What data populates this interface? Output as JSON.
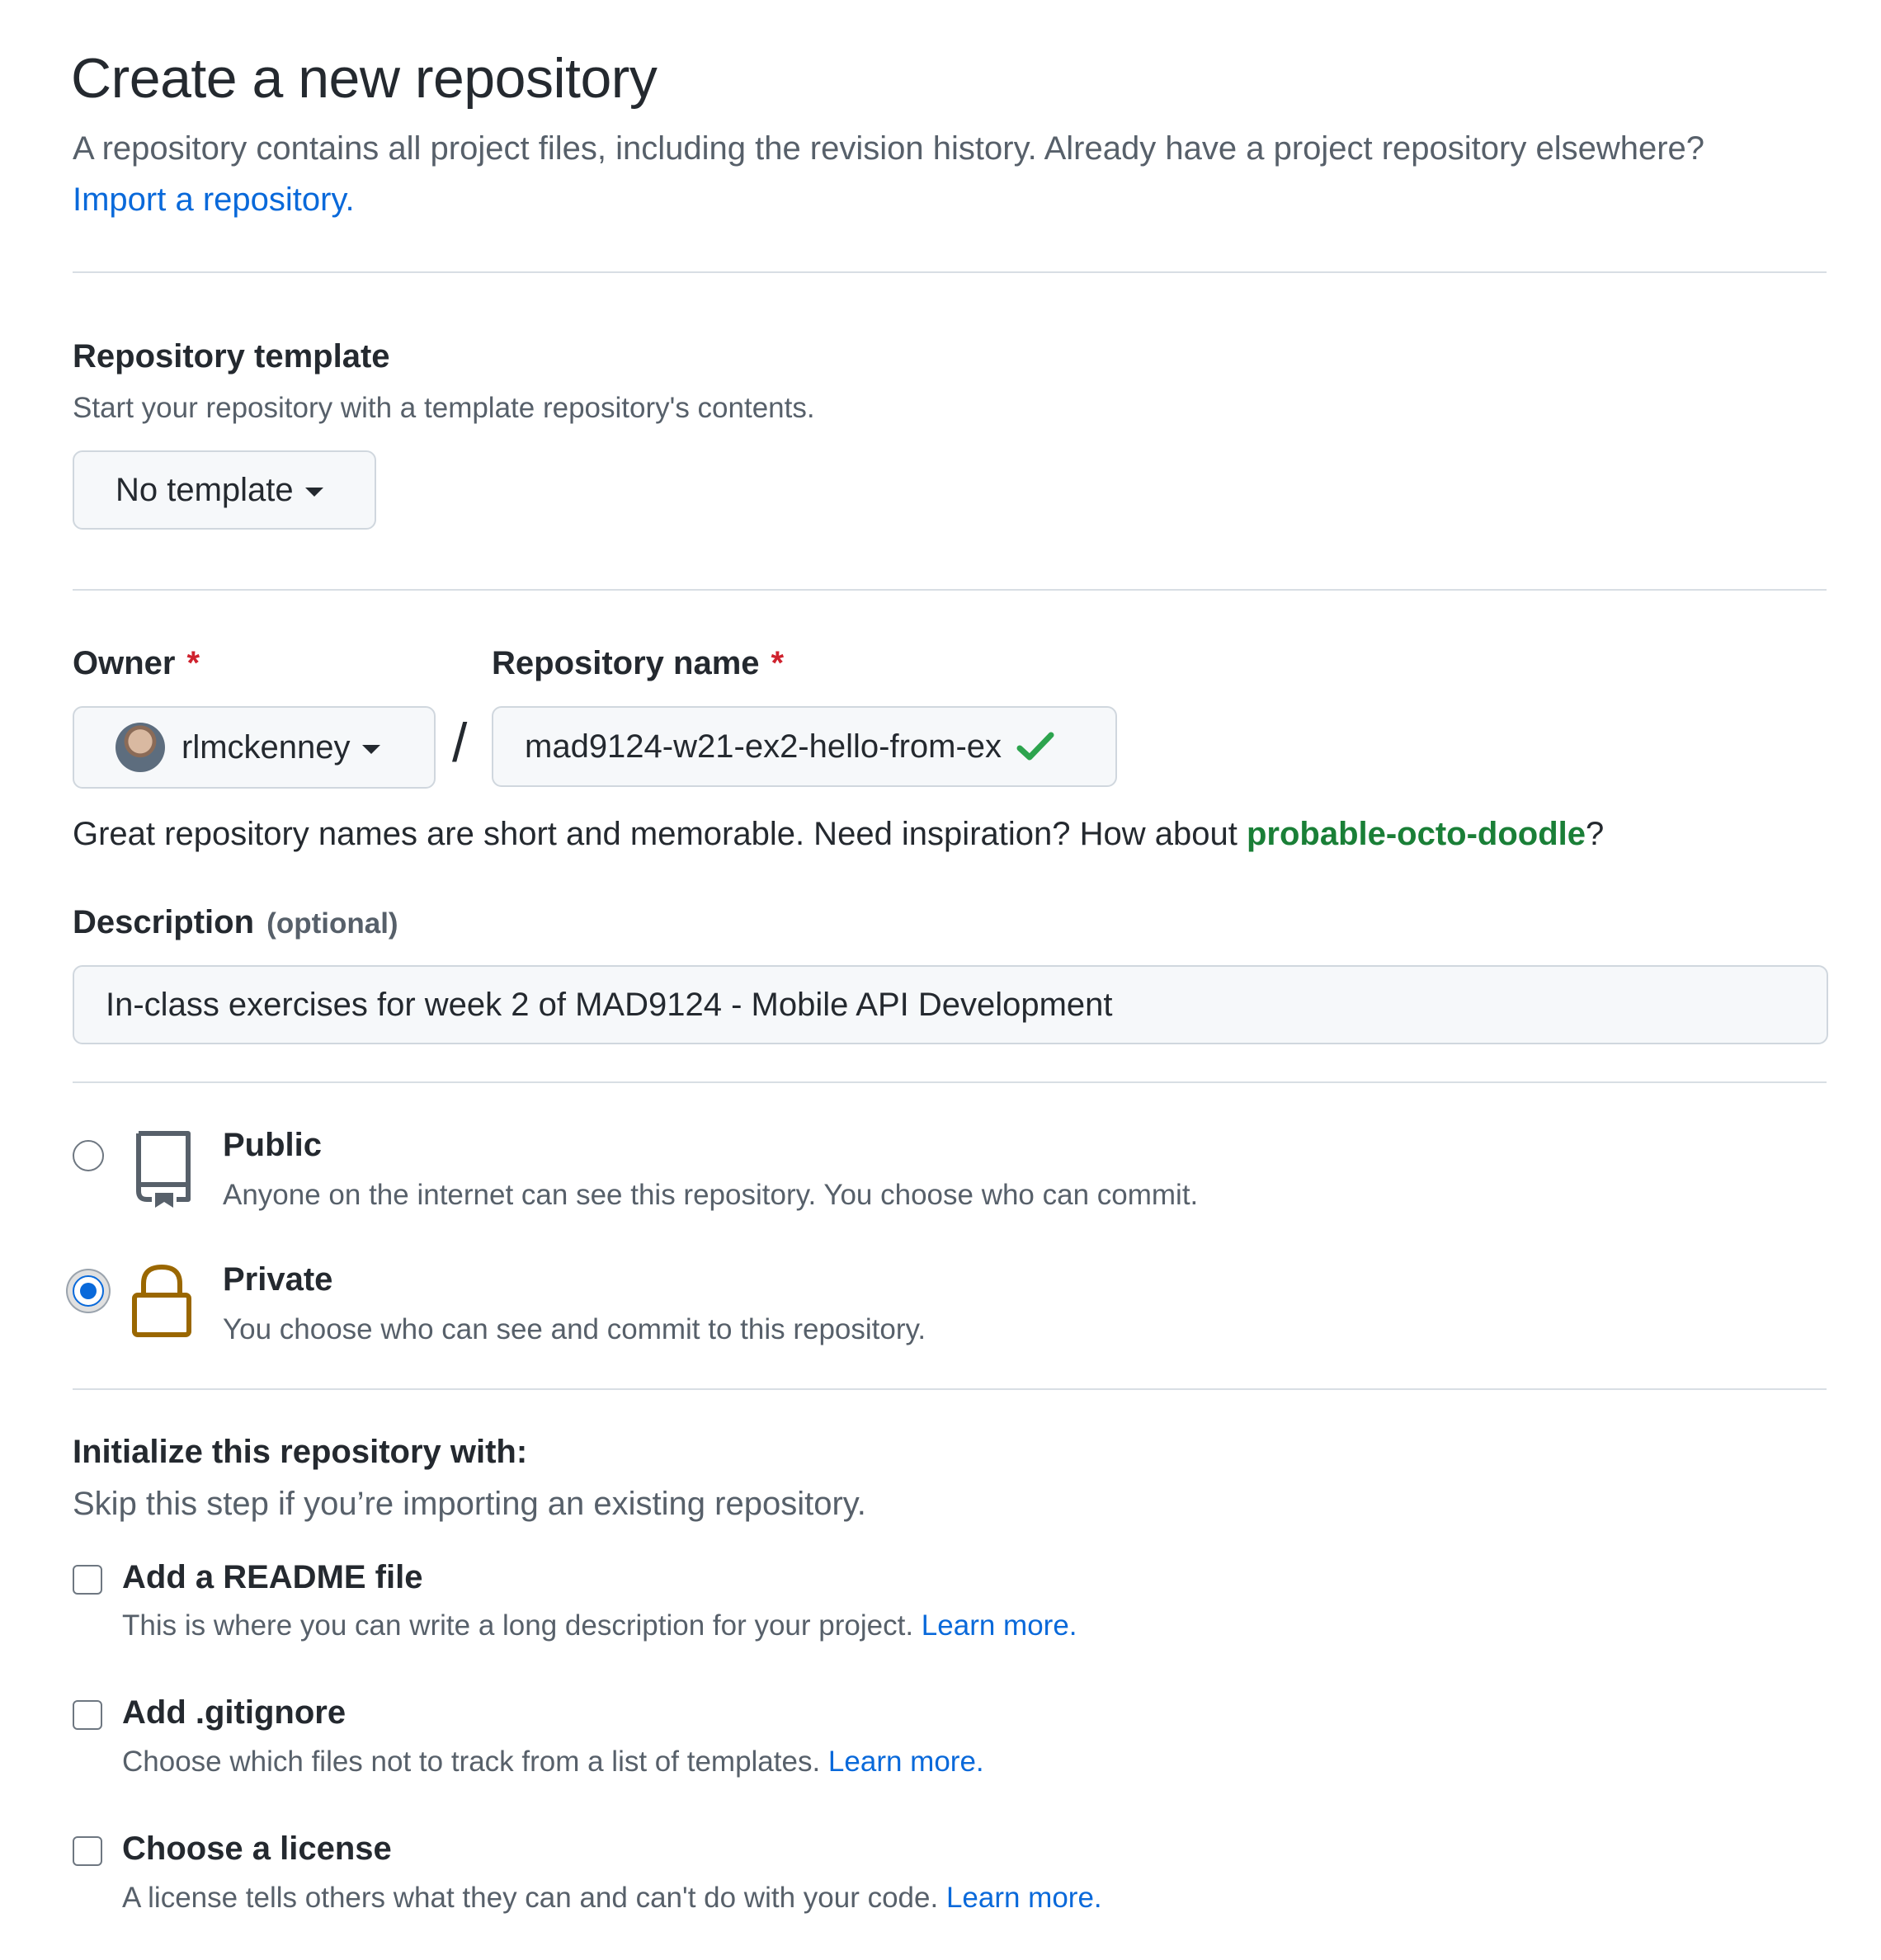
{
  "header": {
    "title": "Create a new repository",
    "subtitle": "A repository contains all project files, including the revision history. Already have a project repository elsewhere?",
    "import_link": "Import a repository."
  },
  "template": {
    "label": "Repository template",
    "note": "Start your repository with a template repository's contents.",
    "button_label": "No template"
  },
  "owner": {
    "label": "Owner",
    "required_mark": "*",
    "value": "rlmckenney"
  },
  "separator": "/",
  "repo_name": {
    "label": "Repository name",
    "required_mark": "*",
    "value": "mad9124-w21-ex2-hello-from-ex",
    "valid_color": "#2da44e"
  },
  "name_hint": {
    "prefix": "Great repository names are short and memorable. Need inspiration? How about ",
    "suggestion": "probable-octo-doodle",
    "suffix": "?"
  },
  "description": {
    "label": "Description",
    "optional": "(optional)",
    "value": "In-class exercises for week 2 of MAD9124 - Mobile API Development"
  },
  "visibility": {
    "selected": "private",
    "public": {
      "title": "Public",
      "desc": "Anyone on the internet can see this repository. You choose who can commit.",
      "icon": "repo-icon"
    },
    "private": {
      "title": "Private",
      "desc": "You choose who can see and commit to this repository.",
      "icon": "lock-icon",
      "icon_color": "#9a6700"
    }
  },
  "initialize": {
    "label": "Initialize this repository with:",
    "note": "Skip this step if you’re importing an existing repository.",
    "options": [
      {
        "title": "Add a README file",
        "desc": "This is where you can write a long description for your project.",
        "link": "Learn more.",
        "checked": false
      },
      {
        "title": "Add .gitignore",
        "desc": "Choose which files not to track from a list of templates.",
        "link": "Learn more.",
        "checked": false
      },
      {
        "title": "Choose a license",
        "desc": "A license tells others what they can and can't do with your code.",
        "link": "Learn more.",
        "checked": false
      }
    ]
  },
  "colors": {
    "link": "#0969da",
    "required": "#cf222e",
    "suggestion": "#1a7f37"
  }
}
